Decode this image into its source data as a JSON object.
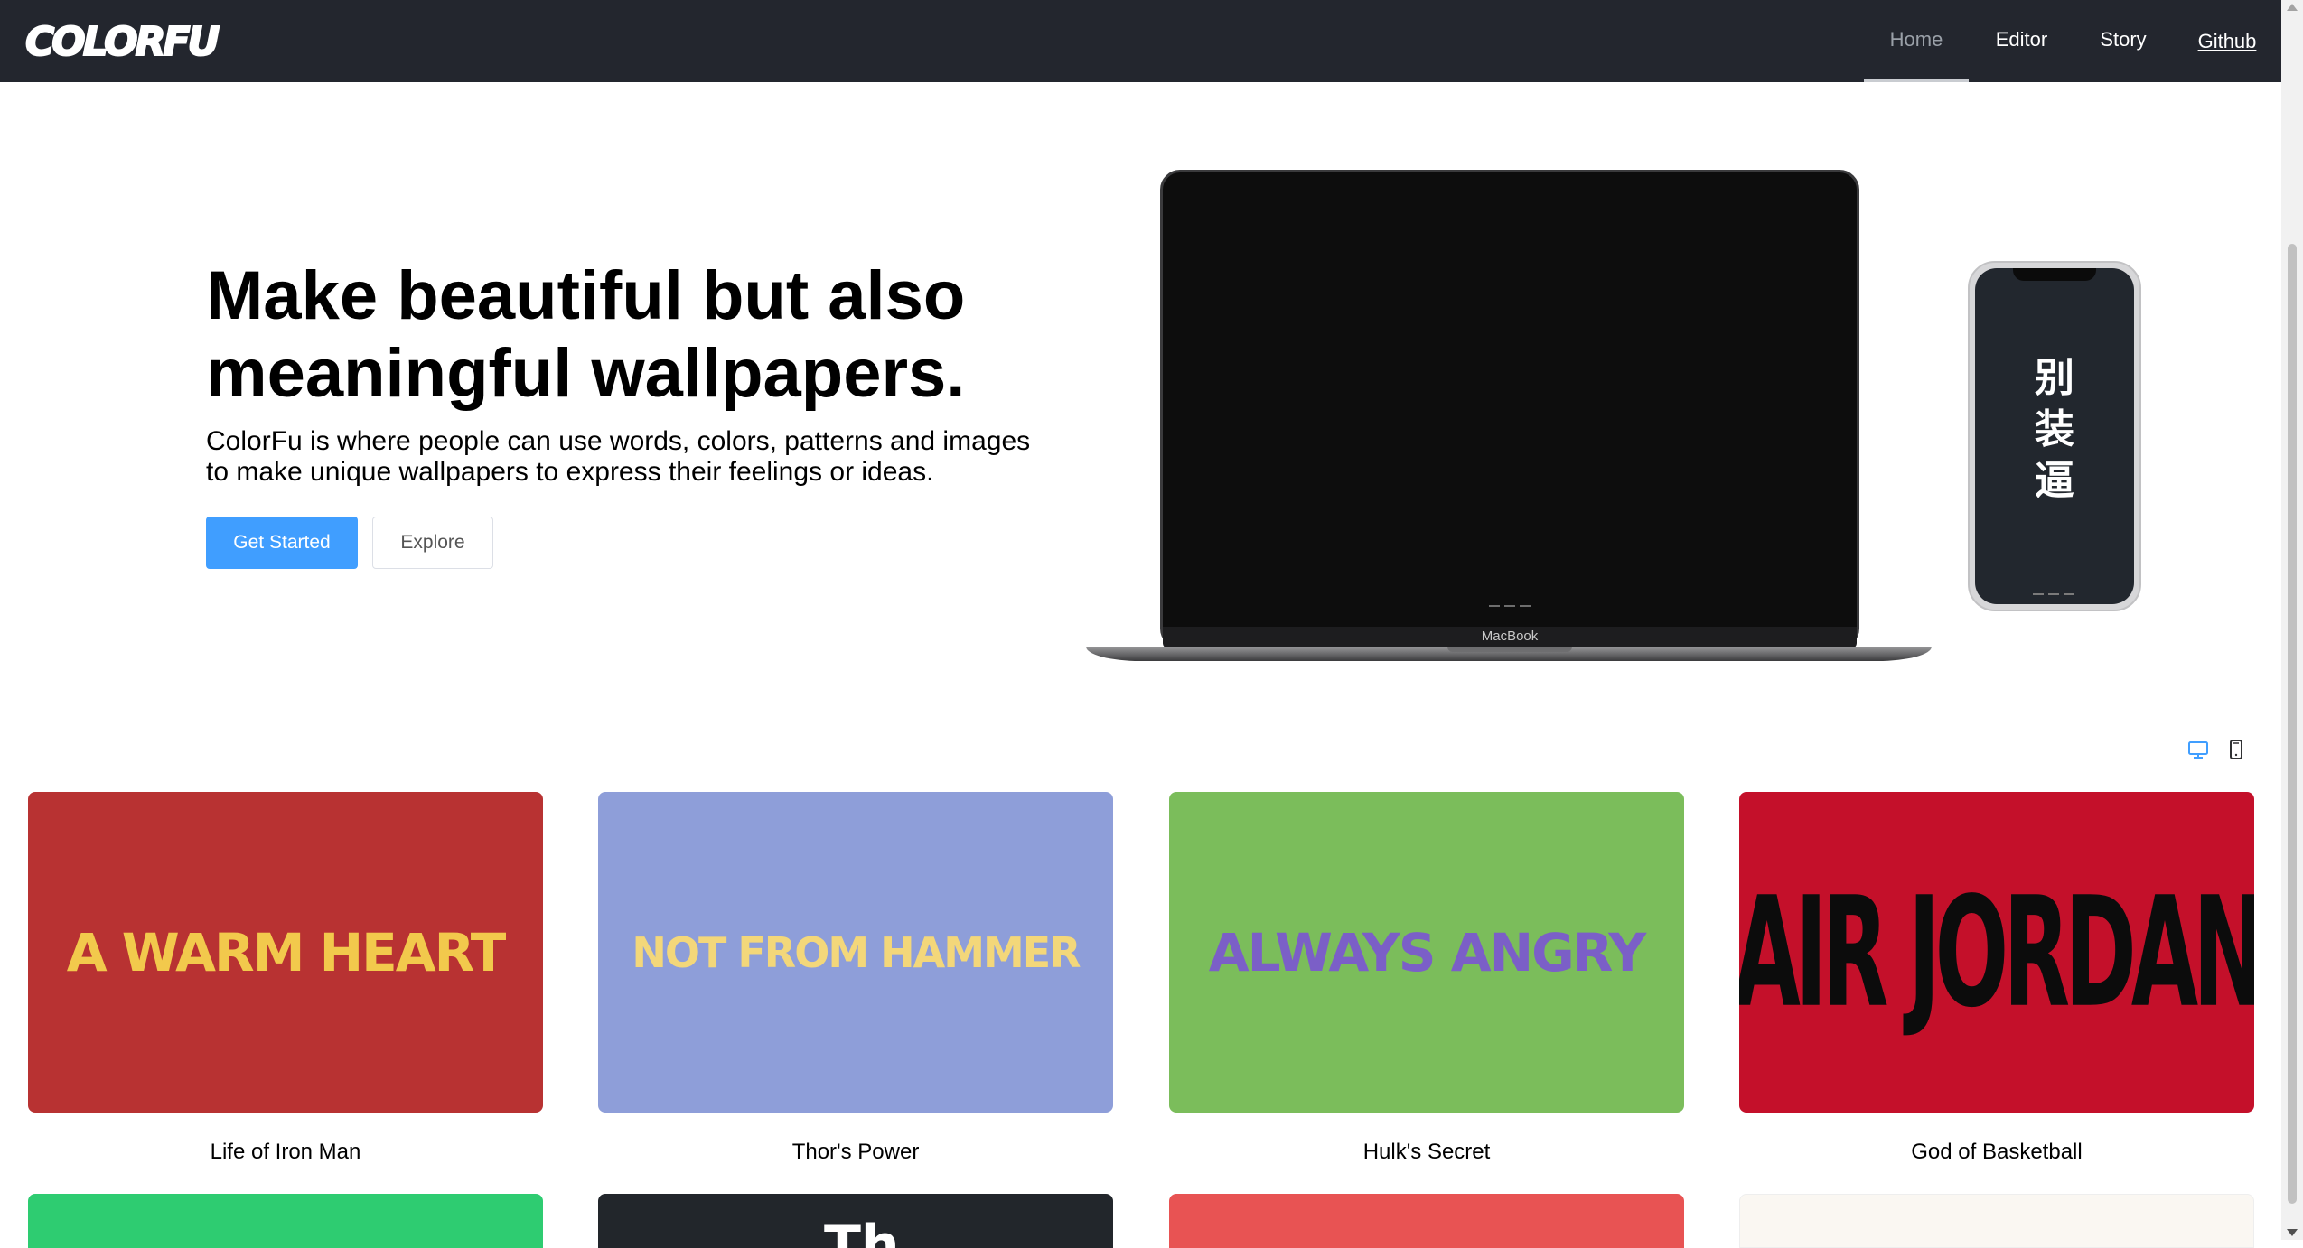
{
  "header": {
    "logo": "COLORFU",
    "nav": [
      {
        "label": "Home",
        "active": true
      },
      {
        "label": "Editor"
      },
      {
        "label": "Story"
      },
      {
        "label": "Github"
      }
    ]
  },
  "hero": {
    "title_line1": "Make beautiful but also",
    "title_line2": "meaningful wallpapers.",
    "description_line1": "ColorFu is where people can use words, colors, patterns and images",
    "description_line2": "to make unique wallpapers to express their feelings or ideas.",
    "primary_button": "Get Started",
    "secondary_button": "Explore"
  },
  "devices": {
    "laptop_label": "MacBook",
    "phone_chars": [
      "别",
      "装",
      "逼"
    ]
  },
  "view_toggles": [
    {
      "icon": "desktop-icon",
      "active": true,
      "color": "#409eff"
    },
    {
      "icon": "mobile-icon",
      "active": false,
      "color": "#303133"
    }
  ],
  "gallery": [
    {
      "text": "A WARM HEART",
      "caption": "Life of Iron Man",
      "bg": "#b83232",
      "fg": "#f2c94c"
    },
    {
      "text": "NOT FROM HAMMER",
      "caption": "Thor's Power",
      "bg": "#8e9ed9",
      "fg": "#f3d77a"
    },
    {
      "text": "ALWAYS ANGRY",
      "caption": "Hulk's Secret",
      "bg": "#7bbd5b",
      "fg": "#7b5fc7"
    },
    {
      "text": "AIR JORDAN",
      "caption": "God of Basketball",
      "bg": "#c4102a",
      "fg": "#0c0c0c"
    }
  ],
  "gallery_row2": [
    {
      "bg": "#2ecc71",
      "glyph": ""
    },
    {
      "bg": "#22262b",
      "glyph": "Th"
    },
    {
      "bg": "#e85353",
      "glyph": ""
    },
    {
      "bg": "#faf7f2",
      "glyph": ""
    }
  ]
}
